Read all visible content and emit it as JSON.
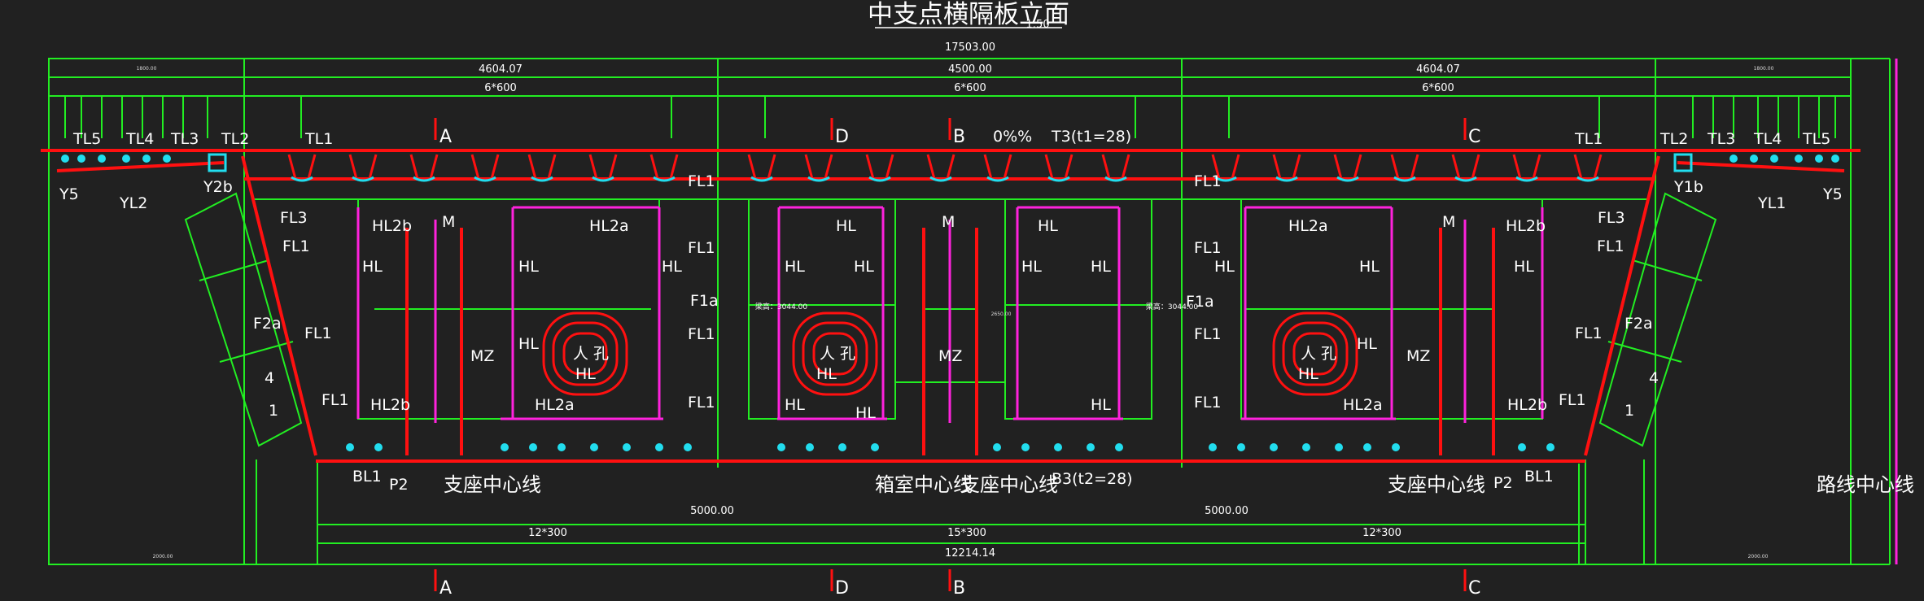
{
  "title": "中支点横隔板立面",
  "title_scale": "1:50",
  "colors": {
    "background": "#212121",
    "outline": "#ff1010",
    "frame": "#22ee22",
    "rebar": "#ff22dd",
    "duct": "#22ddee",
    "text": "#ffffff"
  },
  "dims": {
    "total": "17503.00",
    "left_span": "4604.07",
    "mid_span": "4500.00",
    "right_span": "4604.07",
    "left_div": "6*600",
    "mid_div": "6*600",
    "right_div": "6*600",
    "bottom_total": "12214.14",
    "bottom_left_span": "5000.00",
    "bottom_right_span": "5000.00",
    "bottom_left_div": "12*300",
    "bottom_mid_div": "15*300",
    "bottom_right_div": "12*300",
    "small_tl": "1800.00",
    "small_tr": "1800.00",
    "small_bl": "2000.00",
    "small_br": "2000.00",
    "beam_height_left": "梁高：3044.00",
    "beam_height_right": "梁高：3044.00",
    "mid_small": "2650.00"
  },
  "sections": {
    "a": "A",
    "b": "B",
    "c": "C",
    "d": "D"
  },
  "centerlines": {
    "bearing_left": "支座中心线",
    "box": "箱室中心线",
    "bearing_mid": "支座中心线",
    "bearing_right": "支座中心线",
    "road": "路线中心线"
  },
  "labels": {
    "tl5": "TL5",
    "tl4": "TL4",
    "tl3": "TL3",
    "tl2": "TL2",
    "tl1": "TL1",
    "y5": "Y5",
    "yl2": "YL2",
    "y2b": "Y2b",
    "y1b": "Y1b",
    "yl1": "YL1",
    "fl1": "FL1",
    "fl3": "FL3",
    "f2a": "F2a",
    "f1a": "F1a",
    "hl": "HL",
    "hl2a": "HL2a",
    "hl2b": "HL2b",
    "m": "M",
    "mz": "MZ",
    "hole": "人 孔",
    "bl1": "BL1",
    "p2": "P2",
    "t3": "T3(t1=28)",
    "b3": "B3(t2=28)",
    "slope": "0%%",
    "num4": "4",
    "num1": "1"
  }
}
